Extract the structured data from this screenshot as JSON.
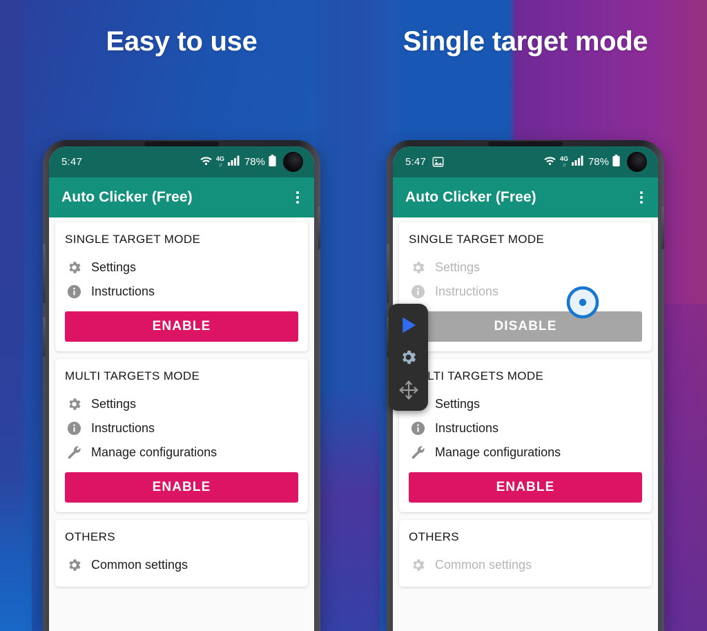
{
  "theme": {
    "accent_pink": "#dd1363",
    "appbar_green": "#14917c",
    "statusbar_green": "#11685c",
    "disabled_gray": "#a6a6a6",
    "target_blue": "#1877cf",
    "play_blue": "#2f6cf0",
    "bg_blue": "#1957b4",
    "bg_purple": "#7a2b99"
  },
  "panels": {
    "left": {
      "heading": "Easy to use",
      "phone": {
        "statusbar": {
          "time": "5:47",
          "has_screenshot_icon": false,
          "icons": [
            "wifi-icon",
            "4g-icon",
            "signal-icon"
          ],
          "battery_percent": "78%",
          "battery_icon": "battery-icon",
          "camera": "front-camera-cutout"
        },
        "appbar": {
          "title": "Auto Clicker (Free)",
          "menu_icon": "overflow-menu-icon"
        },
        "cards": [
          {
            "title": "SINGLE TARGET MODE",
            "rows": [
              {
                "icon": "gear-icon",
                "label": "Settings",
                "dimmed": false
              },
              {
                "icon": "info-icon",
                "label": "Instructions",
                "dimmed": false
              }
            ],
            "button": {
              "label": "ENABLE",
              "style": "enable"
            }
          },
          {
            "title": "MULTI TARGETS MODE",
            "rows": [
              {
                "icon": "gear-icon",
                "label": "Settings",
                "dimmed": false
              },
              {
                "icon": "info-icon",
                "label": "Instructions",
                "dimmed": false
              },
              {
                "icon": "wrench-icon",
                "label": "Manage configurations",
                "dimmed": false
              }
            ],
            "button": {
              "label": "ENABLE",
              "style": "enable"
            }
          },
          {
            "title": "OTHERS",
            "rows": [
              {
                "icon": "gear-icon",
                "label": "Common settings",
                "dimmed": false
              }
            ],
            "button": null
          }
        ]
      },
      "overlays": {
        "float_panel": false,
        "target_marker": false
      }
    },
    "right": {
      "heading": "Single target mode",
      "phone": {
        "statusbar": {
          "time": "5:47",
          "has_screenshot_icon": true,
          "screenshot_icon": "image-icon",
          "icons": [
            "wifi-icon",
            "4g-icon",
            "signal-icon"
          ],
          "battery_percent": "78%",
          "battery_icon": "battery-icon",
          "camera": "front-camera-cutout"
        },
        "appbar": {
          "title": "Auto Clicker (Free)",
          "menu_icon": "overflow-menu-icon"
        },
        "cards": [
          {
            "title": "SINGLE TARGET MODE",
            "rows": [
              {
                "icon": "gear-icon",
                "label": "Settings",
                "dimmed": true
              },
              {
                "icon": "info-icon",
                "label": "Instructions",
                "dimmed": true
              }
            ],
            "button": {
              "label": "DISABLE",
              "style": "disable"
            }
          },
          {
            "title": "MULTI TARGETS MODE",
            "rows": [
              {
                "icon": "gear-icon",
                "label": "Settings",
                "dimmed": false
              },
              {
                "icon": "info-icon",
                "label": "Instructions",
                "dimmed": false
              },
              {
                "icon": "wrench-icon",
                "label": "Manage configurations",
                "dimmed": false
              }
            ],
            "button": {
              "label": "ENABLE",
              "style": "enable"
            }
          },
          {
            "title": "OTHERS",
            "rows": [
              {
                "icon": "gear-icon",
                "label": "Common settings",
                "dimmed": true
              }
            ],
            "button": null
          }
        ]
      },
      "overlays": {
        "float_panel": true,
        "float_items": [
          "play-icon",
          "gear-icon",
          "move-icon"
        ],
        "target_marker": true,
        "target_marker_icon": "click-target-icon"
      }
    }
  }
}
